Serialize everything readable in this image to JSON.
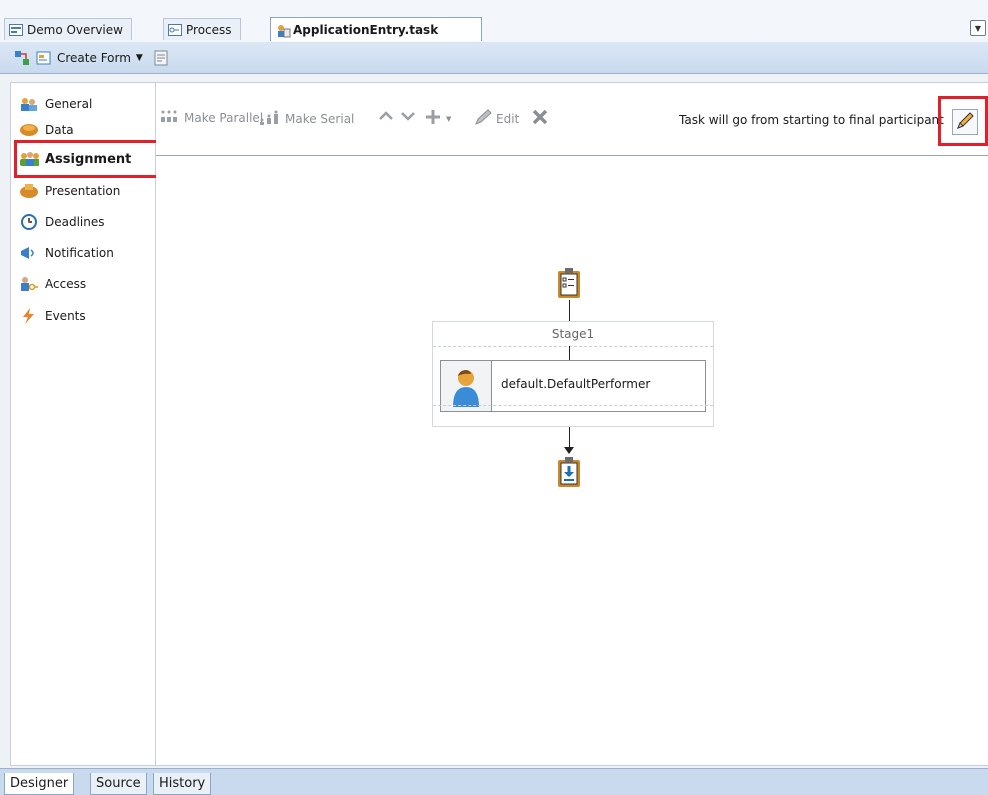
{
  "editor_tabs": [
    {
      "label": "Demo Overview",
      "icon": "overview-icon",
      "active": false
    },
    {
      "label": "Process",
      "icon": "process-icon",
      "active": false
    },
    {
      "label": "ApplicationEntry.task",
      "icon": "task-icon",
      "active": true
    }
  ],
  "toolbar": {
    "create_form_label": "Create Form",
    "icons": [
      "task-overview-icon",
      "form-icon",
      "save-form-icon"
    ]
  },
  "nav": {
    "items": [
      {
        "label": "General",
        "icon": "general-icon"
      },
      {
        "label": "Data",
        "icon": "data-icon"
      },
      {
        "label": "Assignment",
        "icon": "assignment-icon",
        "selected": true
      },
      {
        "label": "Presentation",
        "icon": "presentation-icon"
      },
      {
        "label": "Deadlines",
        "icon": "deadlines-icon"
      },
      {
        "label": "Notification",
        "icon": "notification-icon"
      },
      {
        "label": "Access",
        "icon": "access-icon"
      },
      {
        "label": "Events",
        "icon": "events-icon"
      }
    ]
  },
  "assignment_toolbar": {
    "make_parallel": "Make Parallel",
    "make_serial": "Make Serial",
    "edit": "Edit",
    "routing_text": "Task will go from starting to final participant"
  },
  "diagram": {
    "stage_label": "Stage1",
    "participant": "default.DefaultPerformer"
  },
  "bottom_tabs": [
    {
      "label": "Designer",
      "active": true
    },
    {
      "label": "Source",
      "active": false
    },
    {
      "label": "History",
      "active": false
    }
  ],
  "colors": {
    "highlight": "#e0202a",
    "accent": "#1b6fb5"
  }
}
